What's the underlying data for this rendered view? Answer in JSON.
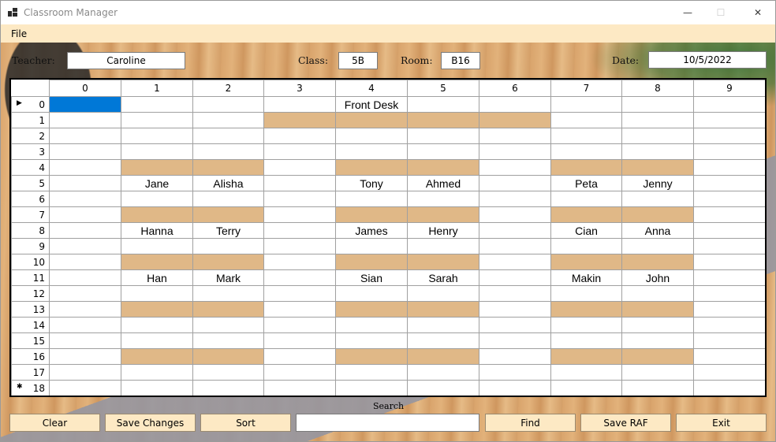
{
  "window": {
    "title": "Classroom Manager",
    "minimize": "—",
    "maximize": "☐",
    "close": "✕"
  },
  "menu": {
    "file": "File"
  },
  "header": {
    "teacher_label": "Teacher:",
    "teacher_value": "Caroline",
    "class_label": "Class:",
    "class_value": "5B",
    "room_label": "Room:",
    "room_value": "B16",
    "date_label": "Date:",
    "date_value": "10/5/2022"
  },
  "grid": {
    "columns": [
      "0",
      "1",
      "2",
      "3",
      "4",
      "5",
      "6",
      "7",
      "8",
      "9"
    ],
    "current_row_marker": "▶",
    "new_row_marker": "✱",
    "rows": [
      {
        "label": "0",
        "cells": [
          "",
          "",
          "",
          "",
          "Front Desk",
          "",
          "",
          "",
          "",
          ""
        ],
        "desk": [],
        "selected": [
          0
        ]
      },
      {
        "label": "1",
        "cells": [
          "",
          "",
          "",
          "",
          "",
          "",
          "",
          "",
          "",
          ""
        ],
        "desk": [
          3,
          4,
          5,
          6
        ],
        "selected": []
      },
      {
        "label": "2",
        "cells": [
          "",
          "",
          "",
          "",
          "",
          "",
          "",
          "",
          "",
          ""
        ],
        "desk": [],
        "selected": []
      },
      {
        "label": "3",
        "cells": [
          "",
          "",
          "",
          "",
          "",
          "",
          "",
          "",
          "",
          ""
        ],
        "desk": [],
        "selected": []
      },
      {
        "label": "4",
        "cells": [
          "",
          "",
          "",
          "",
          "",
          "",
          "",
          "",
          "",
          ""
        ],
        "desk": [
          1,
          2,
          4,
          5,
          7,
          8
        ],
        "selected": []
      },
      {
        "label": "5",
        "cells": [
          "",
          "Jane",
          "Alisha",
          "",
          "Tony",
          "Ahmed",
          "",
          "Peta",
          "Jenny",
          ""
        ],
        "desk": [],
        "selected": []
      },
      {
        "label": "6",
        "cells": [
          "",
          "",
          "",
          "",
          "",
          "",
          "",
          "",
          "",
          ""
        ],
        "desk": [],
        "selected": []
      },
      {
        "label": "7",
        "cells": [
          "",
          "",
          "",
          "",
          "",
          "",
          "",
          "",
          "",
          ""
        ],
        "desk": [
          1,
          2,
          4,
          5,
          7,
          8
        ],
        "selected": []
      },
      {
        "label": "8",
        "cells": [
          "",
          "Hanna",
          "Terry",
          "",
          "James",
          "Henry",
          "",
          "Cian",
          "Anna",
          ""
        ],
        "desk": [],
        "selected": []
      },
      {
        "label": "9",
        "cells": [
          "",
          "",
          "",
          "",
          "",
          "",
          "",
          "",
          "",
          ""
        ],
        "desk": [],
        "selected": []
      },
      {
        "label": "10",
        "cells": [
          "",
          "",
          "",
          "",
          "",
          "",
          "",
          "",
          "",
          ""
        ],
        "desk": [
          1,
          2,
          4,
          5,
          7,
          8
        ],
        "selected": []
      },
      {
        "label": "11",
        "cells": [
          "",
          "Han",
          "Mark",
          "",
          "Sian",
          "Sarah",
          "",
          "Makin",
          "John",
          ""
        ],
        "desk": [],
        "selected": []
      },
      {
        "label": "12",
        "cells": [
          "",
          "",
          "",
          "",
          "",
          "",
          "",
          "",
          "",
          ""
        ],
        "desk": [],
        "selected": []
      },
      {
        "label": "13",
        "cells": [
          "",
          "",
          "",
          "",
          "",
          "",
          "",
          "",
          "",
          ""
        ],
        "desk": [
          1,
          2,
          4,
          5,
          7,
          8
        ],
        "selected": []
      },
      {
        "label": "14",
        "cells": [
          "",
          "",
          "",
          "",
          "",
          "",
          "",
          "",
          "",
          ""
        ],
        "desk": [],
        "selected": []
      },
      {
        "label": "15",
        "cells": [
          "",
          "",
          "",
          "",
          "",
          "",
          "",
          "",
          "",
          ""
        ],
        "desk": [],
        "selected": []
      },
      {
        "label": "16",
        "cells": [
          "",
          "",
          "",
          "",
          "",
          "",
          "",
          "",
          "",
          ""
        ],
        "desk": [
          1,
          2,
          4,
          5,
          7,
          8
        ],
        "selected": []
      },
      {
        "label": "17",
        "cells": [
          "",
          "",
          "",
          "",
          "",
          "",
          "",
          "",
          "",
          ""
        ],
        "desk": [],
        "selected": []
      },
      {
        "label": "18",
        "cells": [
          "",
          "",
          "",
          "",
          "",
          "",
          "",
          "",
          "",
          ""
        ],
        "desk": [],
        "selected": []
      }
    ]
  },
  "search": {
    "label": "Search",
    "value": ""
  },
  "buttons": {
    "clear": "Clear",
    "save_changes": "Save Changes",
    "sort": "Sort",
    "find": "Find",
    "save_raf": "Save RAF",
    "exit": "Exit"
  },
  "colors": {
    "desk": "#e0b887",
    "selection": "#0078d7",
    "menubar": "#fde9c4",
    "button": "#fde9c4"
  }
}
